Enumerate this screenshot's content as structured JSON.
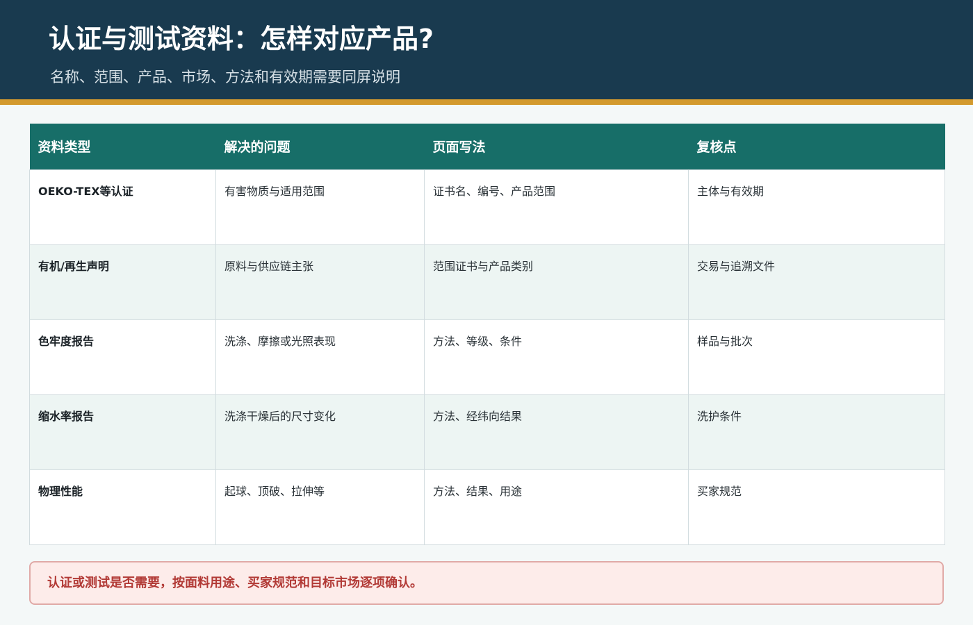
{
  "header": {
    "title": "认证与测试资料：怎样对应产品?",
    "subtitle": "名称、范围、产品、市场、方法和有效期需要同屏说明"
  },
  "table": {
    "columns": [
      "资料类型",
      "解决的问题",
      "页面写法",
      "复核点"
    ],
    "rows": [
      [
        "OEKO-TEX等认证",
        "有害物质与适用范围",
        "证书名、编号、产品范围",
        "主体与有效期"
      ],
      [
        "有机/再生声明",
        "原料与供应链主张",
        "范围证书与产品类别",
        "交易与追溯文件"
      ],
      [
        "色牢度报告",
        "洗涤、摩擦或光照表现",
        "方法、等级、条件",
        "样品与批次"
      ],
      [
        "缩水率报告",
        "洗涤干燥后的尺寸变化",
        "方法、经纬向结果",
        "洗护条件"
      ],
      [
        "物理性能",
        "起球、顶破、拉伸等",
        "方法、结果、用途",
        "买家规范"
      ]
    ]
  },
  "note": {
    "text": "认证或测试是否需要，按面料用途、买家规范和目标市场逐项确认。"
  },
  "colors": {
    "header_bg": "#193a4f",
    "accent_stripe": "#d39a2e",
    "table_header_bg": "#176e68",
    "row_alt_bg": "#edf5f3",
    "note_bg": "#fdecea",
    "note_text": "#b23a36"
  }
}
